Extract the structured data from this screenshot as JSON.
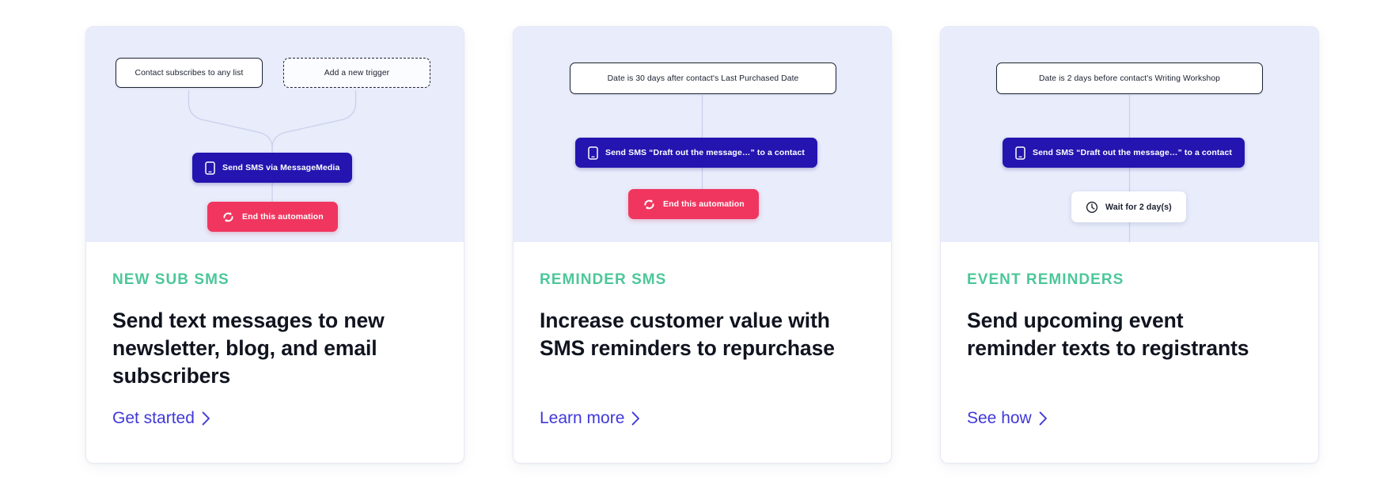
{
  "accents": {
    "eyebrow_green": "#4cc79a",
    "link_blue": "#4038d8",
    "sms_node_navy": "#2415b0",
    "end_node_pink": "#f0365f",
    "diagram_bg": "#e8ecfb",
    "card_bg": "#ffffff",
    "trigger_border": "#1e2433",
    "connector_line": "#c3cbe8"
  },
  "cards": [
    {
      "id": "new-sub-sms",
      "eyebrow": "NEW SUB SMS",
      "headline": "Send text messages to new newsletter, blog, and email subscribers",
      "cta_label": "Get started",
      "cta_icon": "chevron-right-icon",
      "diagram": {
        "nodes": [
          {
            "kind": "trigger",
            "icon": null,
            "label": "Contact subscribes to any list"
          },
          {
            "kind": "trigger-dashed",
            "icon": null,
            "label": "Add a new trigger"
          },
          {
            "kind": "sms",
            "icon": "mobile-phone-icon",
            "label": "Send SMS via MessageMedia"
          },
          {
            "kind": "end",
            "icon": "loop-arrows-icon",
            "label": "End this automation"
          }
        ]
      }
    },
    {
      "id": "reminder-sms",
      "eyebrow": "REMINDER SMS",
      "headline": "Increase customer value with SMS reminders to repurchase",
      "cta_label": "Learn more",
      "cta_icon": "chevron-right-icon",
      "diagram": {
        "nodes": [
          {
            "kind": "trigger",
            "icon": null,
            "label": "Date is 30 days after contact's Last Purchased Date"
          },
          {
            "kind": "sms",
            "icon": "mobile-phone-icon",
            "label": "Send SMS “Draft out the message…” to a contact"
          },
          {
            "kind": "end",
            "icon": "loop-arrows-icon",
            "label": "End this automation"
          }
        ]
      }
    },
    {
      "id": "event-reminders",
      "eyebrow": "EVENT REMINDERS",
      "headline": "Send upcoming event reminder texts to registrants",
      "cta_label": "See how",
      "cta_icon": "chevron-right-icon",
      "diagram": {
        "nodes": [
          {
            "kind": "trigger",
            "icon": null,
            "label": "Date is 2 days before contact's Writing Workshop"
          },
          {
            "kind": "sms",
            "icon": "mobile-phone-icon",
            "label": "Send SMS “Draft out the message…” to a contact"
          },
          {
            "kind": "wait",
            "icon": "clock-icon",
            "label": "Wait for 2 day(s)"
          }
        ]
      }
    }
  ]
}
